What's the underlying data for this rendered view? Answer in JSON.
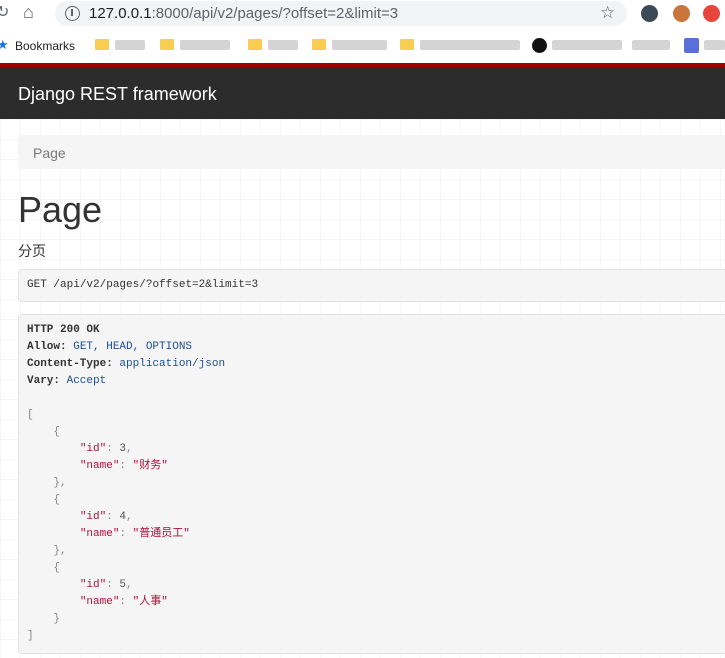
{
  "browser": {
    "url_host": "127.0.0.1",
    "url_path": ":8000/api/v2/pages/?offset=2&limit=3",
    "bookmarks_label": "Bookmarks"
  },
  "app": {
    "brand": "Django REST framework"
  },
  "breadcrumb": {
    "current": "Page"
  },
  "page": {
    "title": "Page",
    "description": "分页"
  },
  "request": {
    "method": "GET",
    "path": "/api/v2/pages/?offset=2&limit=3"
  },
  "response": {
    "status_line": "HTTP 200 OK",
    "headers": [
      {
        "key": "Allow",
        "value": "GET, HEAD, OPTIONS"
      },
      {
        "key": "Content-Type",
        "value": "application/json"
      },
      {
        "key": "Vary",
        "value": "Accept"
      }
    ],
    "items": [
      {
        "id": "3",
        "name": "\"财务\""
      },
      {
        "id": "4",
        "name": "\"普通员工\""
      },
      {
        "id": "5",
        "name": "\"人事\""
      }
    ],
    "labels": {
      "id_key": "\"id\"",
      "name_key": "\"name\""
    }
  }
}
